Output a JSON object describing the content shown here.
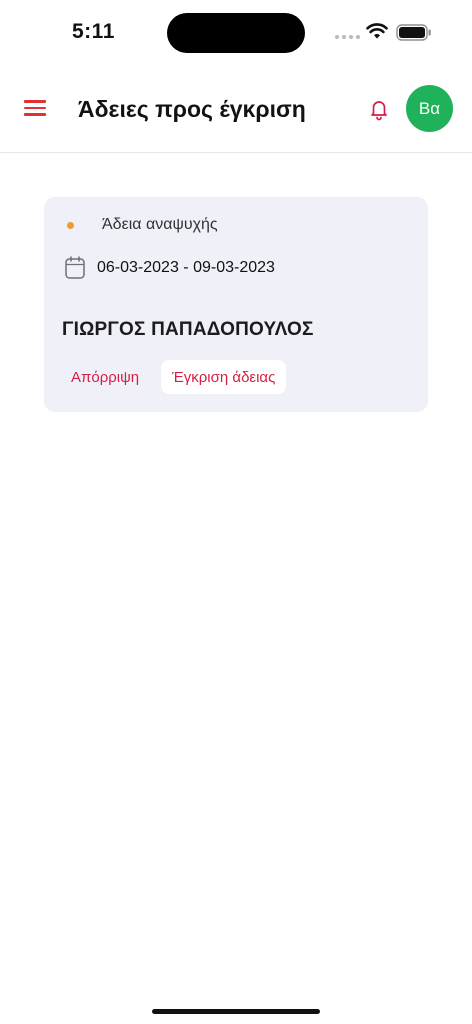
{
  "status_bar": {
    "time": "5:11",
    "icons": [
      "signal-dots-icon",
      "wifi-icon",
      "battery-icon"
    ]
  },
  "header": {
    "title": "Άδειες προς έγκριση",
    "menu_icon": "hamburger-menu-icon",
    "notification_icon": "bell-icon",
    "avatar_initials": "Βα"
  },
  "leave_request": {
    "type": "Άδεια αναψυχής",
    "date_range": "06-03-2023 - 09-03-2023",
    "employee_name": "ΓΙΩΡΓΟΣ ΠΑΠΑΔΟΠΟΥΛΟΣ",
    "reject_label": "Απόρριψη",
    "approve_label": "Έγκριση άδειας"
  },
  "colors": {
    "accent_red": "#d61f46",
    "menu_red": "#e0332f",
    "avatar_green": "#1fb25a",
    "status_dot_orange": "#f29a2e",
    "card_background": "#f0f0f9"
  }
}
